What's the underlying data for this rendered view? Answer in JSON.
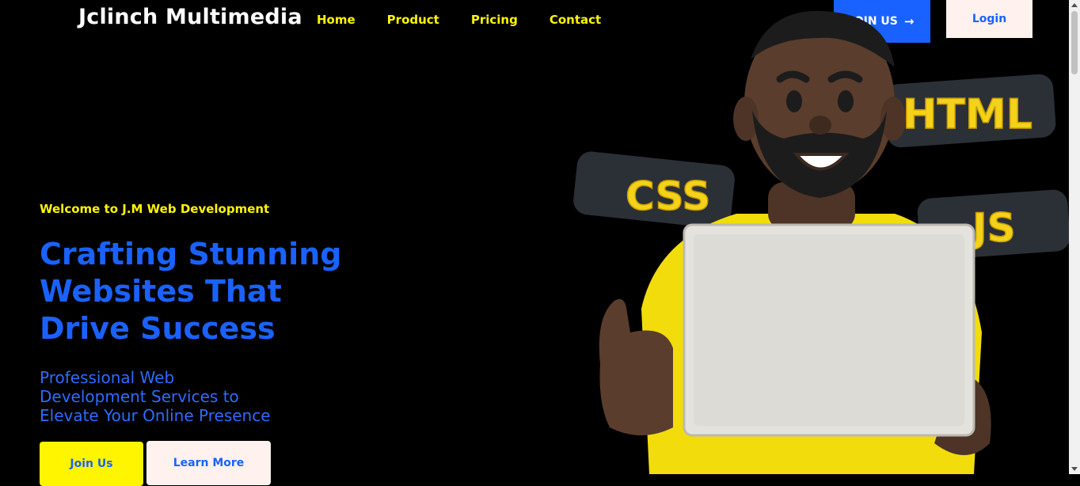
{
  "header": {
    "brand": "Jclinch Multimedia",
    "nav": [
      "Home",
      "Product",
      "Pricing",
      "Contact"
    ],
    "join_label": "JOIN US",
    "login_label": "Login"
  },
  "hero": {
    "welcome": "Welcome to J.M Web Development",
    "headline": "Crafting Stunning Websites That Drive Success",
    "subheadline": "Professional Web Development Services to Elevate Your Online Presence",
    "join_button": "Join Us",
    "learn_button": "Learn More"
  },
  "illustration": {
    "tags": [
      "HTML",
      "CSS",
      "JS"
    ]
  },
  "colors": {
    "background": "#000000",
    "accent_yellow": "#fff500",
    "accent_blue": "#1a62ff",
    "light_button": "#fff1ee"
  }
}
